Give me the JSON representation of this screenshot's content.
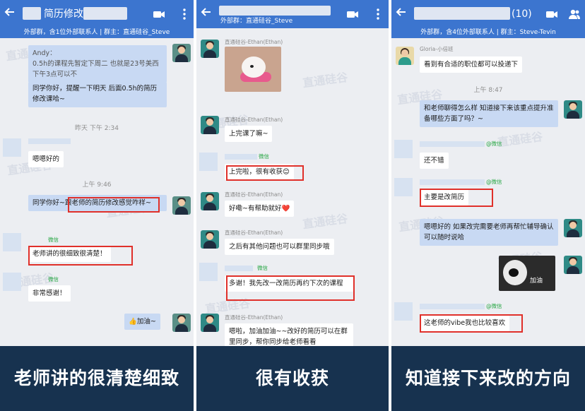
{
  "panels": [
    {
      "header": {
        "title": "简历修改",
        "subtitle": "外部群，含1位外部联系人 | 群主：直通硅谷_Steve"
      },
      "messages": {
        "andy_quote": "Andy：\n0.5h的课程先暂定下周二 也就是23号美西下午3点可以不",
        "m1": "同学你好，提醒一下明天 后面0.5h的简历修改课哈~",
        "time1": "昨天 下午 2:34",
        "m2": "嗯嗯好的",
        "time2": "上午 9:46",
        "m3": "同学你好~跟老师的简历修改感觉咋样~",
        "wx1": "微信",
        "m4": "老师讲的很细致很清楚！",
        "wx2": "微信",
        "m5": "非常感谢！",
        "m6": "👍加油~"
      },
      "caption": "老师讲的很清楚细致"
    },
    {
      "header": {
        "title": "",
        "subtitle": "外部群：直通硅谷_Steve"
      },
      "messages": {
        "n1": "直通硅谷-Ethan(Ethan)",
        "n2": "直通硅谷-Ethan(Ethan)",
        "m1": "上完课了嘛~",
        "wx1": "微信",
        "m2": "上完啦，很有收获😊",
        "n3": "直通硅谷-Ethan(Ethan)",
        "m3": "好嘞~有帮助就好❤️",
        "n4": "直通硅谷-Ethan(Ethan)",
        "m4": "之后有其他问题也可以群里同步哦",
        "wx2": "微信",
        "m5": "多谢！我先改一改简历再约下次的课程",
        "n5": "直通硅谷-Ethan(Ethan)",
        "m6": "嗯啦，加油加油~~改好的简历可以在群里同步，帮你同步给老师看看"
      },
      "caption": "很有收获"
    },
    {
      "header": {
        "title": "(10)",
        "subtitle": "外部群，含4位外部联系人 | 群主：Steve-Tevin"
      },
      "messages": {
        "n1": "Gloria-小倍班",
        "m1": "看到有合适的职位都可以投递下",
        "time1": "上午 8:47",
        "m2": "和老师聊得怎么样 知道接下来该重点提升准备哪些方面了吗？~",
        "wx1": "@微信",
        "m3": "还不错",
        "wx2": "@微信",
        "m4": "主要是改简历",
        "m5": "嗯嗯好的 如果改完需要老师再帮忙辅导确认可以随时说哈",
        "sticker": "加油",
        "wx3": "@微信",
        "m6": "这老师的vibe我也比较喜欢"
      },
      "caption": "知道接下来改的方向"
    }
  ],
  "watermark": "直通硅谷",
  "colors": {
    "header": "#3c75cf",
    "bubble_self": "#c8d9f3",
    "highlight": "#e0302a",
    "caption_bg": "#17324f"
  },
  "icons": [
    "back-arrow-icon",
    "video-call-icon",
    "more-icon",
    "user-icon"
  ]
}
